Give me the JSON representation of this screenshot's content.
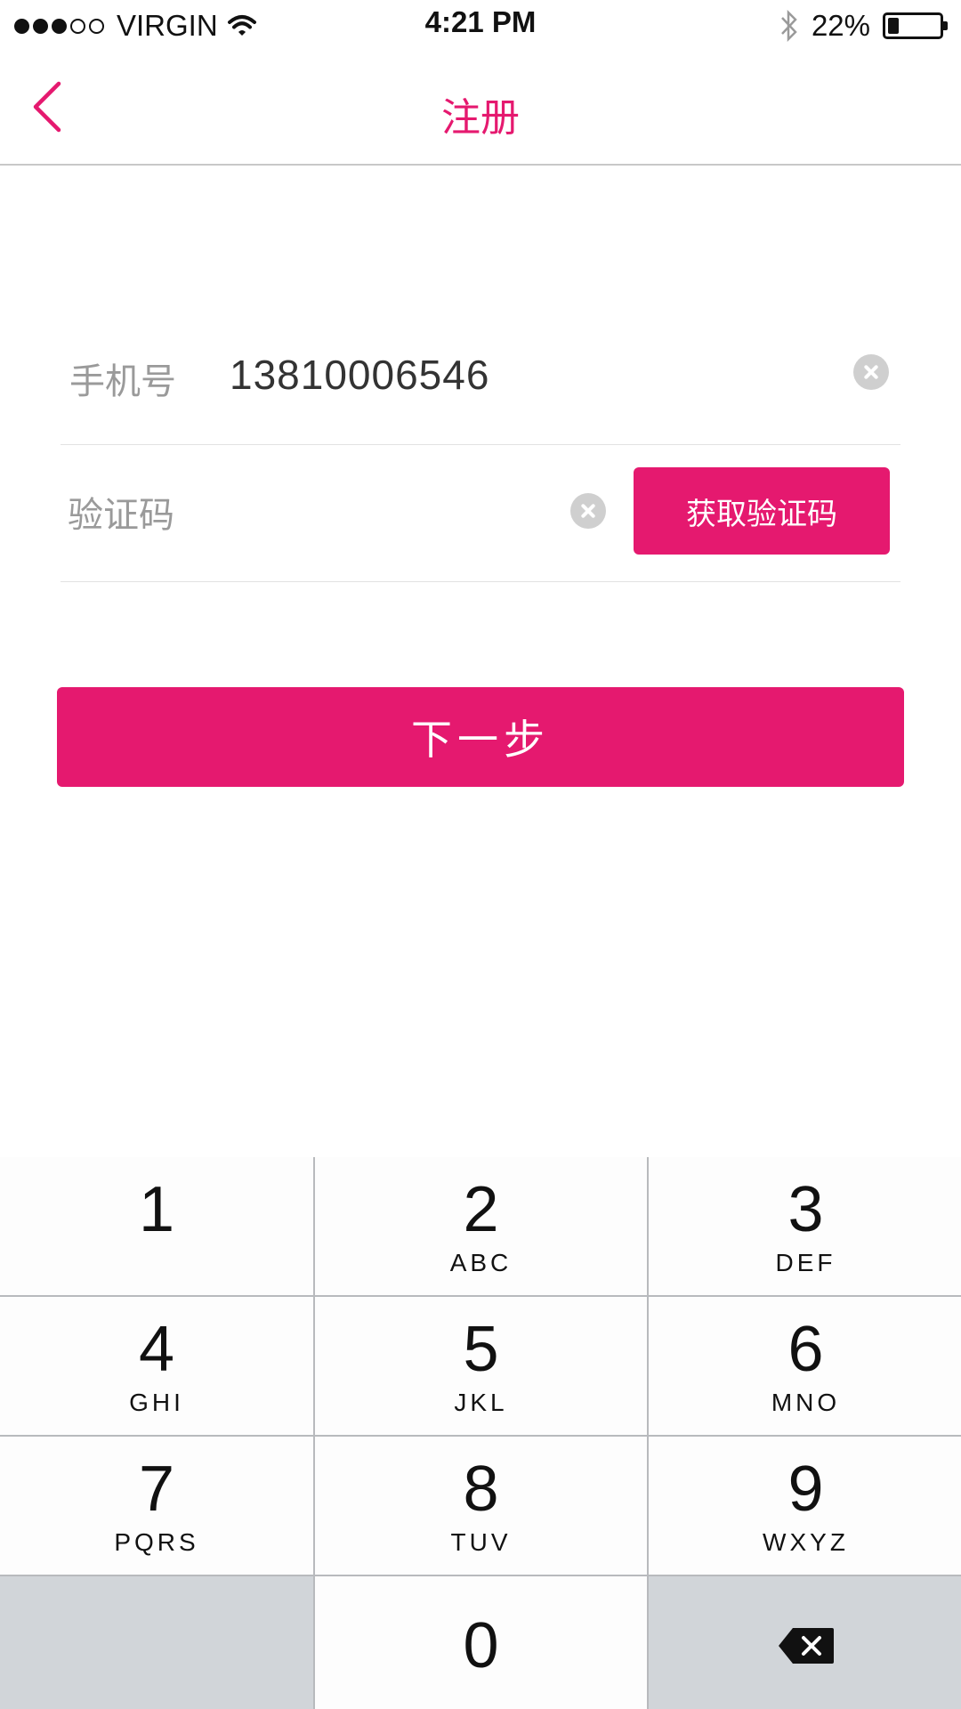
{
  "status_bar": {
    "carrier": "VIRGIN",
    "time": "4:21 PM",
    "battery_percent_label": "22%",
    "battery_level": 0.22,
    "signal_filled": 3,
    "signal_total": 5
  },
  "nav": {
    "title": "注册",
    "back_icon": "chevron-left-icon",
    "accent_color": "#e5196f"
  },
  "form": {
    "phone_label": "手机号",
    "phone_value": "13810006546",
    "code_placeholder": "验证码",
    "get_code_label": "获取验证码",
    "clear_icon": "clear-circle-icon"
  },
  "next_button_label": "下一步",
  "keypad": {
    "keys": [
      {
        "digit": "1",
        "letters": ""
      },
      {
        "digit": "2",
        "letters": "ABC"
      },
      {
        "digit": "3",
        "letters": "DEF"
      },
      {
        "digit": "4",
        "letters": "GHI"
      },
      {
        "digit": "5",
        "letters": "JKL"
      },
      {
        "digit": "6",
        "letters": "MNO"
      },
      {
        "digit": "7",
        "letters": "PQRS"
      },
      {
        "digit": "8",
        "letters": "TUV"
      },
      {
        "digit": "9",
        "letters": "WXYZ"
      },
      {
        "digit": "0",
        "letters": ""
      }
    ],
    "delete_icon": "backspace-icon"
  }
}
